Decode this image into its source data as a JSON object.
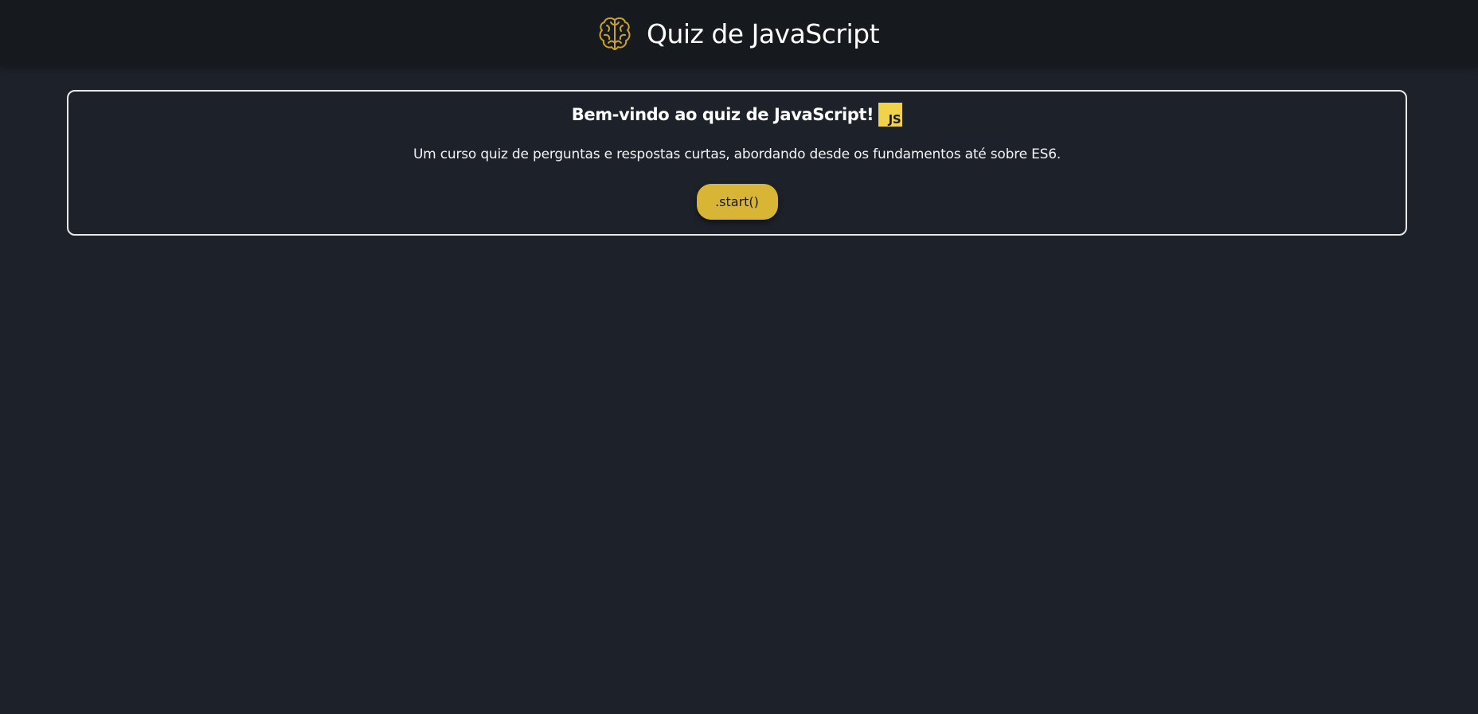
{
  "header": {
    "logo_icon": "brain-icon",
    "title": "Quiz de JavaScript"
  },
  "welcome": {
    "heading": "Bem-vindo ao quiz de JavaScript!",
    "badge": "JS",
    "description": "Um curso quiz de perguntas e respostas curtas, abordando desde os fundamentos até sobre ES6.",
    "start_label": ".start()"
  },
  "colors": {
    "page_background": "#1d222a",
    "header_background": "#16191d",
    "accent": "#d9b536",
    "js_badge": "#f0d34a",
    "card_border": "#e7e9ec"
  }
}
